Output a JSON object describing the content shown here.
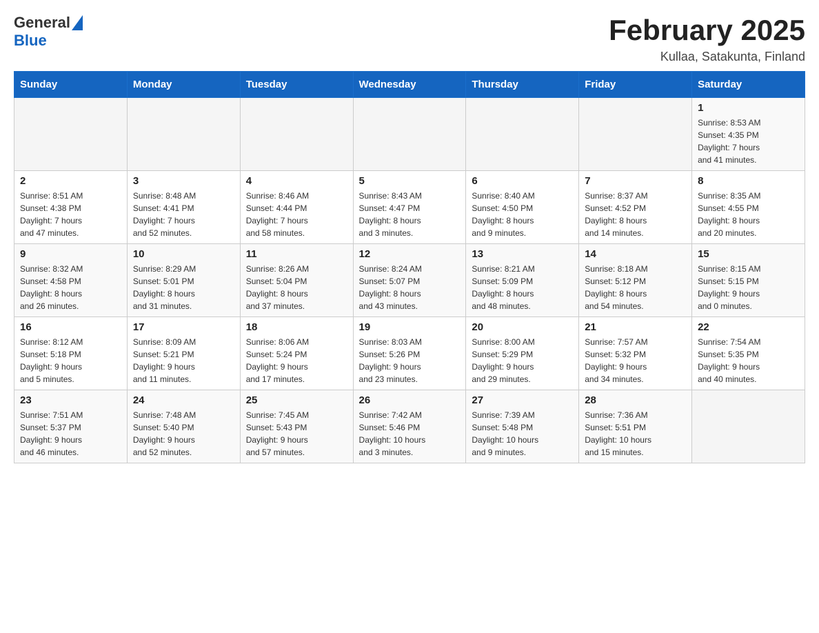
{
  "header": {
    "logo_general": "General",
    "logo_blue": "Blue",
    "title": "February 2025",
    "subtitle": "Kullaa, Satakunta, Finland"
  },
  "days_of_week": [
    "Sunday",
    "Monday",
    "Tuesday",
    "Wednesday",
    "Thursday",
    "Friday",
    "Saturday"
  ],
  "weeks": [
    [
      {
        "day": "",
        "info": ""
      },
      {
        "day": "",
        "info": ""
      },
      {
        "day": "",
        "info": ""
      },
      {
        "day": "",
        "info": ""
      },
      {
        "day": "",
        "info": ""
      },
      {
        "day": "",
        "info": ""
      },
      {
        "day": "1",
        "info": "Sunrise: 8:53 AM\nSunset: 4:35 PM\nDaylight: 7 hours\nand 41 minutes."
      }
    ],
    [
      {
        "day": "2",
        "info": "Sunrise: 8:51 AM\nSunset: 4:38 PM\nDaylight: 7 hours\nand 47 minutes."
      },
      {
        "day": "3",
        "info": "Sunrise: 8:48 AM\nSunset: 4:41 PM\nDaylight: 7 hours\nand 52 minutes."
      },
      {
        "day": "4",
        "info": "Sunrise: 8:46 AM\nSunset: 4:44 PM\nDaylight: 7 hours\nand 58 minutes."
      },
      {
        "day": "5",
        "info": "Sunrise: 8:43 AM\nSunset: 4:47 PM\nDaylight: 8 hours\nand 3 minutes."
      },
      {
        "day": "6",
        "info": "Sunrise: 8:40 AM\nSunset: 4:50 PM\nDaylight: 8 hours\nand 9 minutes."
      },
      {
        "day": "7",
        "info": "Sunrise: 8:37 AM\nSunset: 4:52 PM\nDaylight: 8 hours\nand 14 minutes."
      },
      {
        "day": "8",
        "info": "Sunrise: 8:35 AM\nSunset: 4:55 PM\nDaylight: 8 hours\nand 20 minutes."
      }
    ],
    [
      {
        "day": "9",
        "info": "Sunrise: 8:32 AM\nSunset: 4:58 PM\nDaylight: 8 hours\nand 26 minutes."
      },
      {
        "day": "10",
        "info": "Sunrise: 8:29 AM\nSunset: 5:01 PM\nDaylight: 8 hours\nand 31 minutes."
      },
      {
        "day": "11",
        "info": "Sunrise: 8:26 AM\nSunset: 5:04 PM\nDaylight: 8 hours\nand 37 minutes."
      },
      {
        "day": "12",
        "info": "Sunrise: 8:24 AM\nSunset: 5:07 PM\nDaylight: 8 hours\nand 43 minutes."
      },
      {
        "day": "13",
        "info": "Sunrise: 8:21 AM\nSunset: 5:09 PM\nDaylight: 8 hours\nand 48 minutes."
      },
      {
        "day": "14",
        "info": "Sunrise: 8:18 AM\nSunset: 5:12 PM\nDaylight: 8 hours\nand 54 minutes."
      },
      {
        "day": "15",
        "info": "Sunrise: 8:15 AM\nSunset: 5:15 PM\nDaylight: 9 hours\nand 0 minutes."
      }
    ],
    [
      {
        "day": "16",
        "info": "Sunrise: 8:12 AM\nSunset: 5:18 PM\nDaylight: 9 hours\nand 5 minutes."
      },
      {
        "day": "17",
        "info": "Sunrise: 8:09 AM\nSunset: 5:21 PM\nDaylight: 9 hours\nand 11 minutes."
      },
      {
        "day": "18",
        "info": "Sunrise: 8:06 AM\nSunset: 5:24 PM\nDaylight: 9 hours\nand 17 minutes."
      },
      {
        "day": "19",
        "info": "Sunrise: 8:03 AM\nSunset: 5:26 PM\nDaylight: 9 hours\nand 23 minutes."
      },
      {
        "day": "20",
        "info": "Sunrise: 8:00 AM\nSunset: 5:29 PM\nDaylight: 9 hours\nand 29 minutes."
      },
      {
        "day": "21",
        "info": "Sunrise: 7:57 AM\nSunset: 5:32 PM\nDaylight: 9 hours\nand 34 minutes."
      },
      {
        "day": "22",
        "info": "Sunrise: 7:54 AM\nSunset: 5:35 PM\nDaylight: 9 hours\nand 40 minutes."
      }
    ],
    [
      {
        "day": "23",
        "info": "Sunrise: 7:51 AM\nSunset: 5:37 PM\nDaylight: 9 hours\nand 46 minutes."
      },
      {
        "day": "24",
        "info": "Sunrise: 7:48 AM\nSunset: 5:40 PM\nDaylight: 9 hours\nand 52 minutes."
      },
      {
        "day": "25",
        "info": "Sunrise: 7:45 AM\nSunset: 5:43 PM\nDaylight: 9 hours\nand 57 minutes."
      },
      {
        "day": "26",
        "info": "Sunrise: 7:42 AM\nSunset: 5:46 PM\nDaylight: 10 hours\nand 3 minutes."
      },
      {
        "day": "27",
        "info": "Sunrise: 7:39 AM\nSunset: 5:48 PM\nDaylight: 10 hours\nand 9 minutes."
      },
      {
        "day": "28",
        "info": "Sunrise: 7:36 AM\nSunset: 5:51 PM\nDaylight: 10 hours\nand 15 minutes."
      },
      {
        "day": "",
        "info": ""
      }
    ]
  ]
}
